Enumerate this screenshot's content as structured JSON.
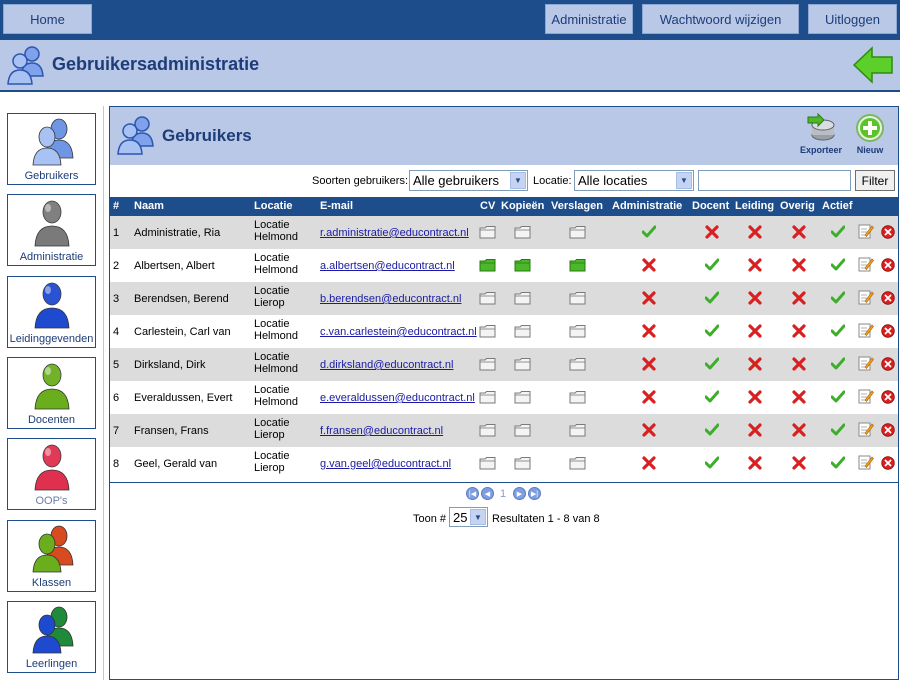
{
  "nav": {
    "home": "Home",
    "administratie": "Administratie",
    "wachtwoord": "Wachtwoord wijzigen",
    "uitloggen": "Uitloggen"
  },
  "header": {
    "title": "Gebruikersadministratie"
  },
  "sidebar": {
    "items": [
      {
        "label": "Gebruikers",
        "icon": "users-icon",
        "color": "#5a7ed8"
      },
      {
        "label": "Administratie",
        "icon": "admin-user-icon",
        "color": "#7a7a7a"
      },
      {
        "label": "Leidinggevenden",
        "icon": "manager-user-icon",
        "color": "#1e4ad0"
      },
      {
        "label": "Docenten",
        "icon": "teacher-user-icon",
        "color": "#6aae1e"
      },
      {
        "label": "OOP's",
        "icon": "oop-user-icon",
        "color": "#e03050"
      },
      {
        "label": "Klassen",
        "icon": "classes-icon",
        "color": "#d84a20"
      },
      {
        "label": "Leerlingen",
        "icon": "students-icon",
        "color": "#1e8a3a"
      }
    ]
  },
  "main": {
    "title": "Gebruikers",
    "export_label": "Exporteer",
    "new_label": "Nieuw"
  },
  "filters": {
    "type_label": "Soorten gebruikers:",
    "type_value": "Alle gebruikers",
    "location_label": "Locatie:",
    "location_value": "Alle locaties",
    "search_value": "",
    "filter_button": "Filter"
  },
  "table": {
    "columns": [
      "#",
      "Naam",
      "Locatie",
      "E-mail",
      "CV",
      "Kopieën",
      "Verslagen",
      "Administratie",
      "Docent",
      "Leiding",
      "Overig",
      "Actief"
    ],
    "rows": [
      {
        "num": "1",
        "name": "Administratie, Ria",
        "loc1": "Locatie",
        "loc2": "Helmond",
        "email": "r.administratie@educontract.nl",
        "files": false,
        "admin": true,
        "docent": false,
        "leiding": false,
        "overig": false,
        "actief": true
      },
      {
        "num": "2",
        "name": "Albertsen, Albert",
        "loc1": "Locatie",
        "loc2": "Helmond",
        "email": "a.albertsen@educontract.nl",
        "files": true,
        "admin": false,
        "docent": true,
        "leiding": false,
        "overig": false,
        "actief": true
      },
      {
        "num": "3",
        "name": "Berendsen, Berend",
        "loc1": "Locatie",
        "loc2": "Lierop",
        "email": "b.berendsen@educontract.nl",
        "files": false,
        "admin": false,
        "docent": true,
        "leiding": false,
        "overig": false,
        "actief": true
      },
      {
        "num": "4",
        "name": "Carlestein, Carl van",
        "loc1": "Locatie",
        "loc2": "Helmond",
        "email": "c.van.carlestein@educontract.nl",
        "files": false,
        "admin": false,
        "docent": true,
        "leiding": false,
        "overig": false,
        "actief": true
      },
      {
        "num": "5",
        "name": "Dirksland, Dirk",
        "loc1": "Locatie",
        "loc2": "Helmond",
        "email": "d.dirksland@educontract.nl",
        "files": false,
        "admin": false,
        "docent": true,
        "leiding": false,
        "overig": false,
        "actief": true
      },
      {
        "num": "6",
        "name": "Everaldussen, Evert",
        "loc1": "Locatie",
        "loc2": "Helmond",
        "email": "e.everaldussen@educontract.nl",
        "files": false,
        "admin": false,
        "docent": true,
        "leiding": false,
        "overig": false,
        "actief": true
      },
      {
        "num": "7",
        "name": "Fransen, Frans",
        "loc1": "Locatie",
        "loc2": "Lierop",
        "email": "f.fransen@educontract.nl",
        "files": false,
        "admin": false,
        "docent": true,
        "leiding": false,
        "overig": false,
        "actief": true
      },
      {
        "num": "8",
        "name": "Geel, Gerald van",
        "loc1": "Locatie",
        "loc2": "Lierop",
        "email": "g.van.geel@educontract.nl",
        "files": false,
        "admin": false,
        "docent": true,
        "leiding": false,
        "overig": false,
        "actief": true
      }
    ]
  },
  "pager": {
    "current_page": "1",
    "show_label": "Toon #",
    "page_size": "25",
    "results": "Resultaten 1 - 8 van 8"
  },
  "colors": {
    "nav_bg": "#1e4d8c",
    "band_bg": "#b8c8e6",
    "accent_text": "#1e3c78",
    "row_alt": "#dcdcdc",
    "check": "#3cae2a",
    "cross": "#d82020",
    "delete": "#d82020"
  }
}
